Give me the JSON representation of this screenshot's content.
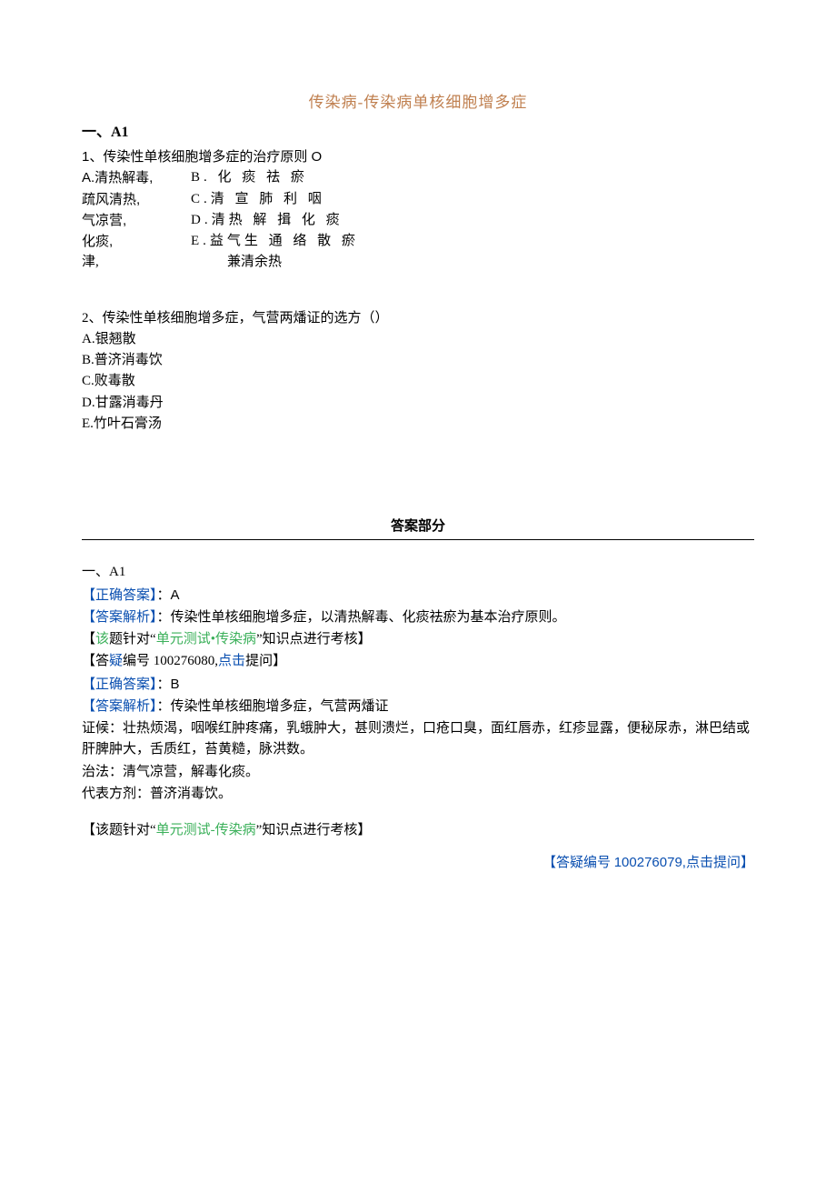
{
  "title": "传染病-传染病单核细胞增多症",
  "section1_head": "一、A1",
  "q1": {
    "stem": "1、传染性单核细胞增多症的治疗原则 O",
    "rows": [
      {
        "left": "A.清热解毒,",
        "right": "B. 化 痰 祛 瘀"
      },
      {
        "left": "疏风清热,",
        "right": "C.清 宣 肺 利 咽"
      },
      {
        "left": "气凉营,",
        "right": "D.清热 解 揖 化 痰"
      },
      {
        "left": "化痰,",
        "right": "E.益气生 通 络 散 瘀"
      },
      {
        "left": "津,",
        "right": "兼清余热"
      }
    ]
  },
  "q2": {
    "stem": "2、传染性单核细胞增多症，气营两燔证的选方（）",
    "opts": [
      "A.银翘散",
      "B.普济消毒饮",
      "C.败毒散",
      "D.甘露消毒丹",
      "E.竹叶石膏汤"
    ]
  },
  "answers_head": "答案部分",
  "ans_sec_head": "一、A1",
  "ans1": {
    "correct_label": "【正确答案】",
    "correct_val": "：A",
    "jiexi_label": "【答案解析】",
    "jiexi_text": "：传染性单核细胞增多症，以清热解毒、化痰祛瘀为基本治疗原则。",
    "topic_pre": "【",
    "topic_gai": "该",
    "topic_mid": "题针对“",
    "topic_link": "单元测试•传染病",
    "topic_post": "”知识点进行考核】",
    "doubt_pre": "【答",
    "doubt_yi": "疑",
    "doubt_mid1": "编号 100276080,",
    "doubt_link": "点击",
    "doubt_post": "提问】"
  },
  "ans2": {
    "correct_label": "【正确答案】",
    "correct_val": "：B",
    "jiexi_label": "【答案解析】",
    "jiexi_text": "：传染性单核细胞增多症，气营两燔证",
    "lines": [
      "证候：壮热烦渴，咽喉红肿疼痛，乳蛾肿大，甚则溃烂，口疮口臭，面红唇赤，红疹显露，便秘尿赤，淋巴结或肝脾肿大，舌质红，苔黄糙，脉洪数。",
      "治法：清气凉营，解毒化痰。",
      "代表方剂：普济消毒饮。"
    ],
    "topic_pre": "【该题针对“",
    "topic_link": "单元测试-传染病",
    "topic_post": "”知识点进行考核】",
    "footer_pre": "【答疑编号 ",
    "footer_num": "100276079,",
    "footer_link": "点击提问",
    "footer_post": "】"
  }
}
